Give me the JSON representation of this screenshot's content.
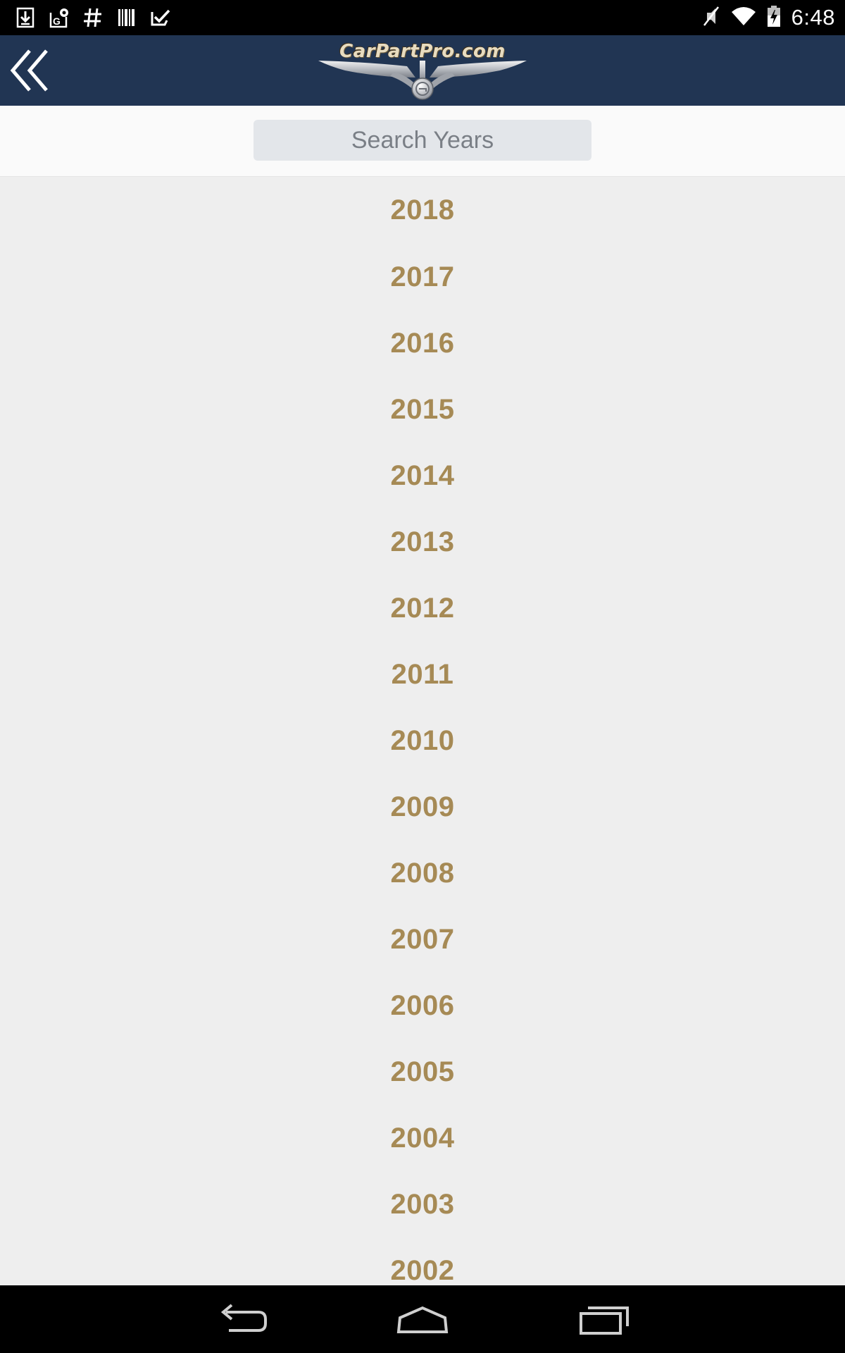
{
  "status_bar": {
    "time": "6:48",
    "left_icons": [
      "download-icon",
      "maps-icon",
      "hashtag-icon",
      "barcode-icon",
      "tasks-icon"
    ],
    "right_icons": [
      "mute-icon",
      "wifi-icon",
      "battery-charging-icon"
    ]
  },
  "app_bar": {
    "back_icon": "double-chevron-left-icon",
    "logo_text": "CarPartPro.com"
  },
  "search": {
    "placeholder": "Search Years",
    "value": ""
  },
  "years": {
    "items": [
      {
        "label": "2018"
      },
      {
        "label": "2017"
      },
      {
        "label": "2016"
      },
      {
        "label": "2015"
      },
      {
        "label": "2014"
      },
      {
        "label": "2013"
      },
      {
        "label": "2012"
      },
      {
        "label": "2011"
      },
      {
        "label": "2010"
      },
      {
        "label": "2009"
      },
      {
        "label": "2008"
      },
      {
        "label": "2007"
      },
      {
        "label": "2006"
      },
      {
        "label": "2005"
      },
      {
        "label": "2004"
      },
      {
        "label": "2003"
      },
      {
        "label": "2002"
      }
    ]
  },
  "nav_bar": {
    "icons": [
      "back-icon",
      "home-icon",
      "recent-apps-icon"
    ]
  },
  "colors": {
    "app_bar": "#213553",
    "year_text": "#a68a55",
    "list_background": "#eeeeee",
    "search_background": "#e3e6ea"
  }
}
